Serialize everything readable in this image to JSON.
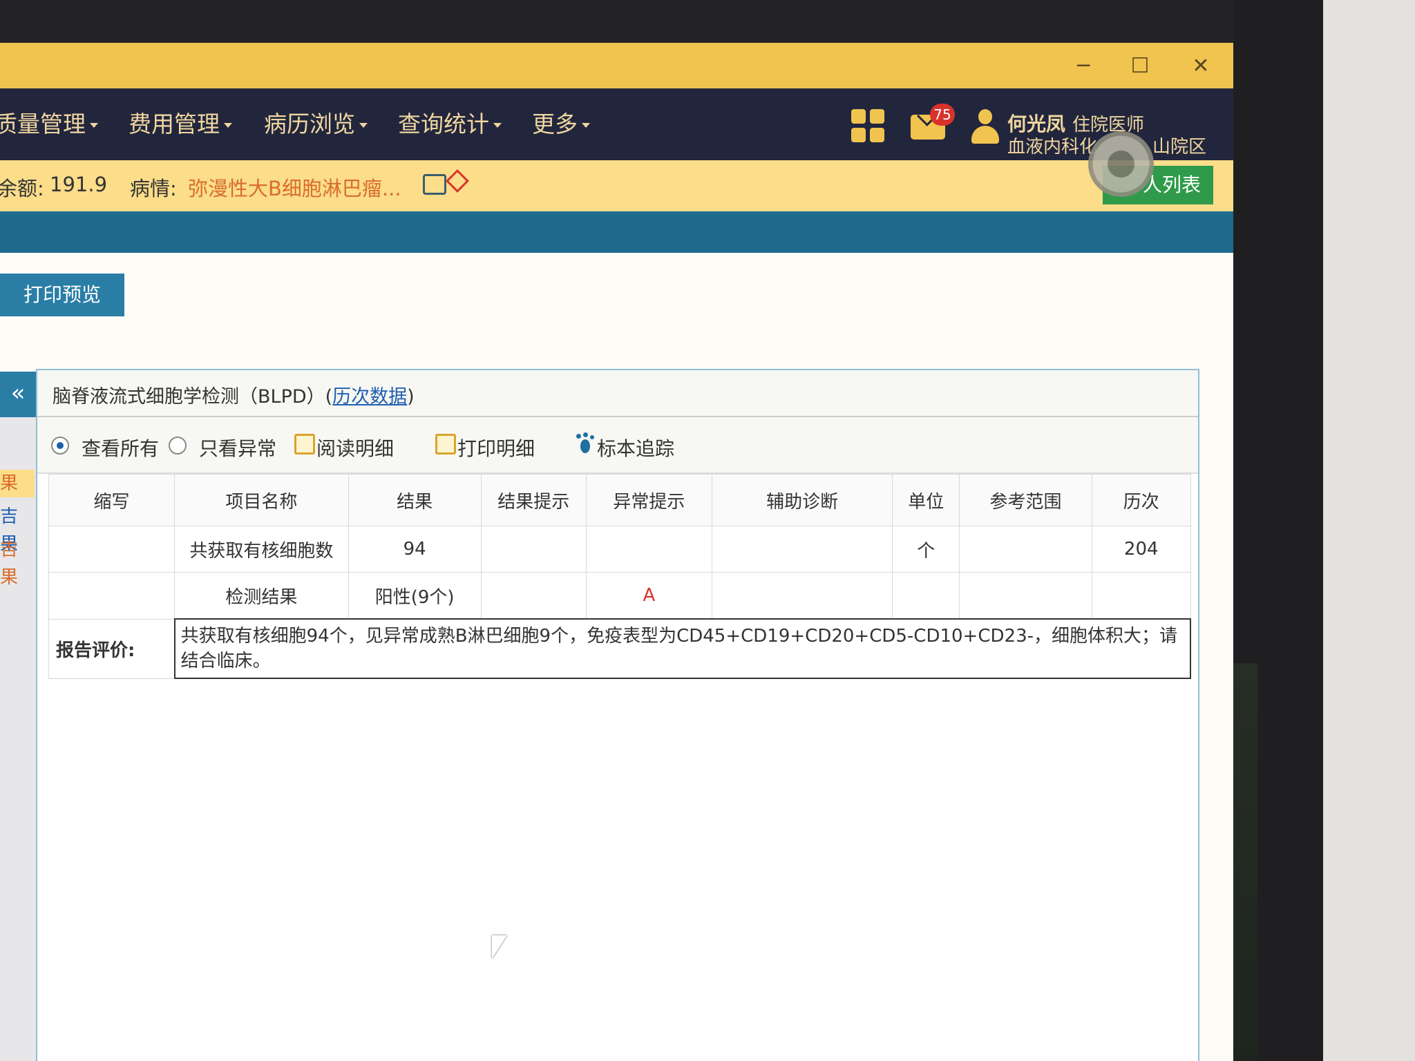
{
  "window": {
    "min_label": "─",
    "max_label": "☐",
    "close_label": "✕"
  },
  "nav": {
    "items": [
      "质量管理",
      "费用管理",
      "病历浏览",
      "查询统计",
      "更多"
    ],
    "notification_count": "75",
    "user": {
      "name": "何光凤",
      "role": "住院医师",
      "dept": "血液内科化",
      "campus": "山院区"
    }
  },
  "patient": {
    "balance_label": "余额:",
    "balance_value": "191.9",
    "condition_label": "病情:",
    "condition_value": "弥漫性大B细胞淋巴瘤...",
    "list_button": "人列表"
  },
  "content": {
    "print_preview": "打印预览",
    "collapse_label": "«",
    "left_tabs": [
      "果",
      "吉果",
      "吉果"
    ]
  },
  "panel": {
    "title": "脑脊液流式细胞学检测（BLPD）(",
    "history_link": "历次数据",
    "title_close": ")"
  },
  "toolbar": {
    "view_all": "查看所有",
    "view_abnormal": "只看异常",
    "read_detail": "阅读明细",
    "print_detail": "打印明细",
    "specimen_track": "标本追踪"
  },
  "table": {
    "headers": [
      "缩写",
      "项目名称",
      "结果",
      "结果提示",
      "异常提示",
      "辅助诊断",
      "单位",
      "参考范围",
      "历次"
    ],
    "rows": [
      {
        "abbr": "",
        "name": "共获取有核细胞数",
        "result": "94",
        "hint": "",
        "abnormal": "",
        "diag": "",
        "unit": "个",
        "range": "",
        "history": "204"
      },
      {
        "abbr": "",
        "name": "检测结果",
        "result": "阳性(9个)",
        "hint": "",
        "abnormal": "A",
        "diag": "",
        "unit": "",
        "range": "",
        "history": ""
      }
    ],
    "report_label": "报告评价:",
    "report_text": "共获取有核细胞94个，见异常成熟B淋巴细胞9个，免疫表型为CD45+CD19+CD20+CD5-CD10+CD23-，细胞体积大；请结合临床。"
  },
  "colors": {
    "title_bar": "#f1c450",
    "nav_bar": "#22263d",
    "accent_blue": "#2a7ea6",
    "abnormal_red": "#d9322b"
  }
}
